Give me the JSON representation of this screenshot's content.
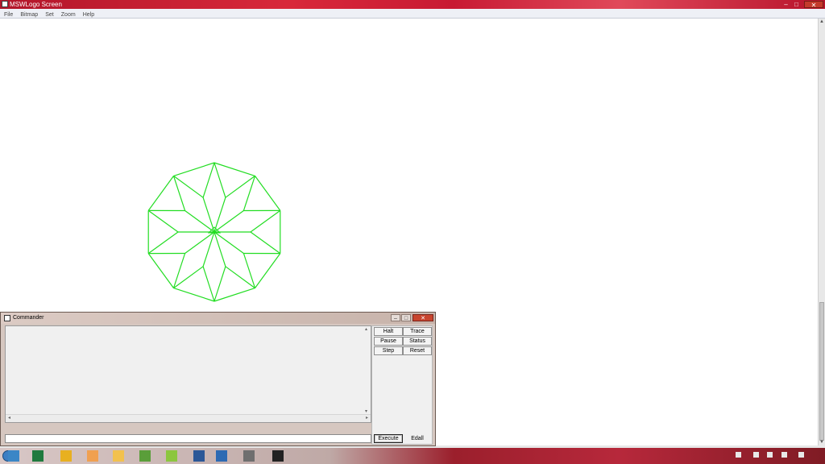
{
  "window": {
    "title": "MSWLogo Screen",
    "controls": {
      "minimize": "–",
      "maximize": "□",
      "close": "✕"
    }
  },
  "menu": [
    {
      "label": "File"
    },
    {
      "label": "Bitmap"
    },
    {
      "label": "Set"
    },
    {
      "label": "Zoom"
    },
    {
      "label": "Help"
    }
  ],
  "canvas": {
    "pen_color": "#22dd22",
    "background": "#ffffff"
  },
  "commander": {
    "title": "Commander",
    "buttons": {
      "halt": "Halt",
      "trace": "Trace",
      "pause": "Pause",
      "status": "Status",
      "step": "Step",
      "reset": "Reset",
      "execute": "Execute",
      "edall": "Edall"
    },
    "input_value": "",
    "output_text": ""
  },
  "taskbar": {
    "apps": [
      {
        "icon": "windows-explorer-icon",
        "color": "#3b86c6"
      },
      {
        "icon": "excel-icon",
        "color": "#1f7a3e"
      },
      {
        "icon": "paint-icon",
        "color": "#e8b020"
      },
      {
        "icon": "app-icon",
        "color": "#f0a050"
      },
      {
        "icon": "folder-icon",
        "color": "#f2c14e"
      },
      {
        "icon": "app-icon",
        "color": "#5a9e3a"
      },
      {
        "icon": "app-icon",
        "color": "#8cc63f"
      },
      {
        "icon": "word-icon",
        "color": "#2b5797"
      },
      {
        "icon": "app-icon",
        "color": "#2d6ab3"
      },
      {
        "icon": "app-icon",
        "color": "#6f6f6f"
      },
      {
        "icon": "logo-icon",
        "color": "#222222"
      }
    ]
  }
}
